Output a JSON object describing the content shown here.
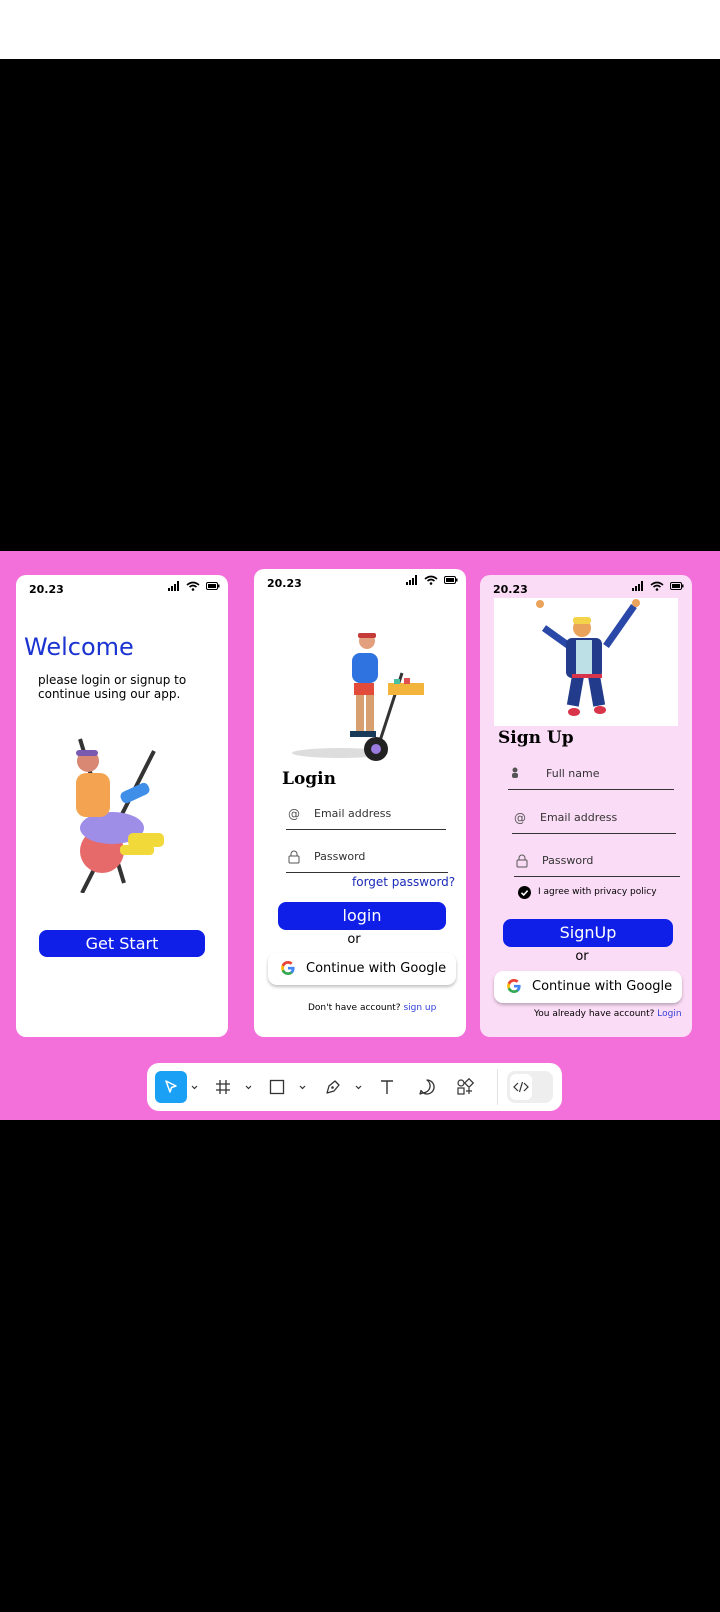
{
  "colors": {
    "canvas": "#f36fd9",
    "accent": "#0f1fe8",
    "link": "#3340d8",
    "welcome": "#1a33d1",
    "signup_bg": "#fbdcf6"
  },
  "screen1": {
    "time": "20.23",
    "title": "Welcome",
    "subtitle": "please login or signup to continue using our app.",
    "button": "Get Start"
  },
  "screen2": {
    "time": "20.23",
    "title": "Login",
    "email_placeholder": "Email address",
    "password_placeholder": "Password",
    "forgot": "forget password?",
    "login_button": "login",
    "or": "or",
    "google_button": "Continue with Google",
    "footer_text": "Don't have account?",
    "footer_link": "sign up"
  },
  "screen3": {
    "time": "20.23",
    "title": "Sign Up",
    "name_placeholder": "Full name",
    "email_placeholder": "Email address",
    "password_placeholder": "Password",
    "agree": "I agree with privacy policy",
    "signup_button": "SignUp",
    "or": "or",
    "google_button": "Continue with Google",
    "footer_text": "You already have account?",
    "footer_link": "Login"
  },
  "toolbar": {
    "icons": [
      "move-icon",
      "frame-icon",
      "rectangle-icon",
      "pen-icon",
      "text-icon",
      "comment-icon",
      "components-icon",
      "dev-mode-icon"
    ],
    "active": "move-icon"
  }
}
